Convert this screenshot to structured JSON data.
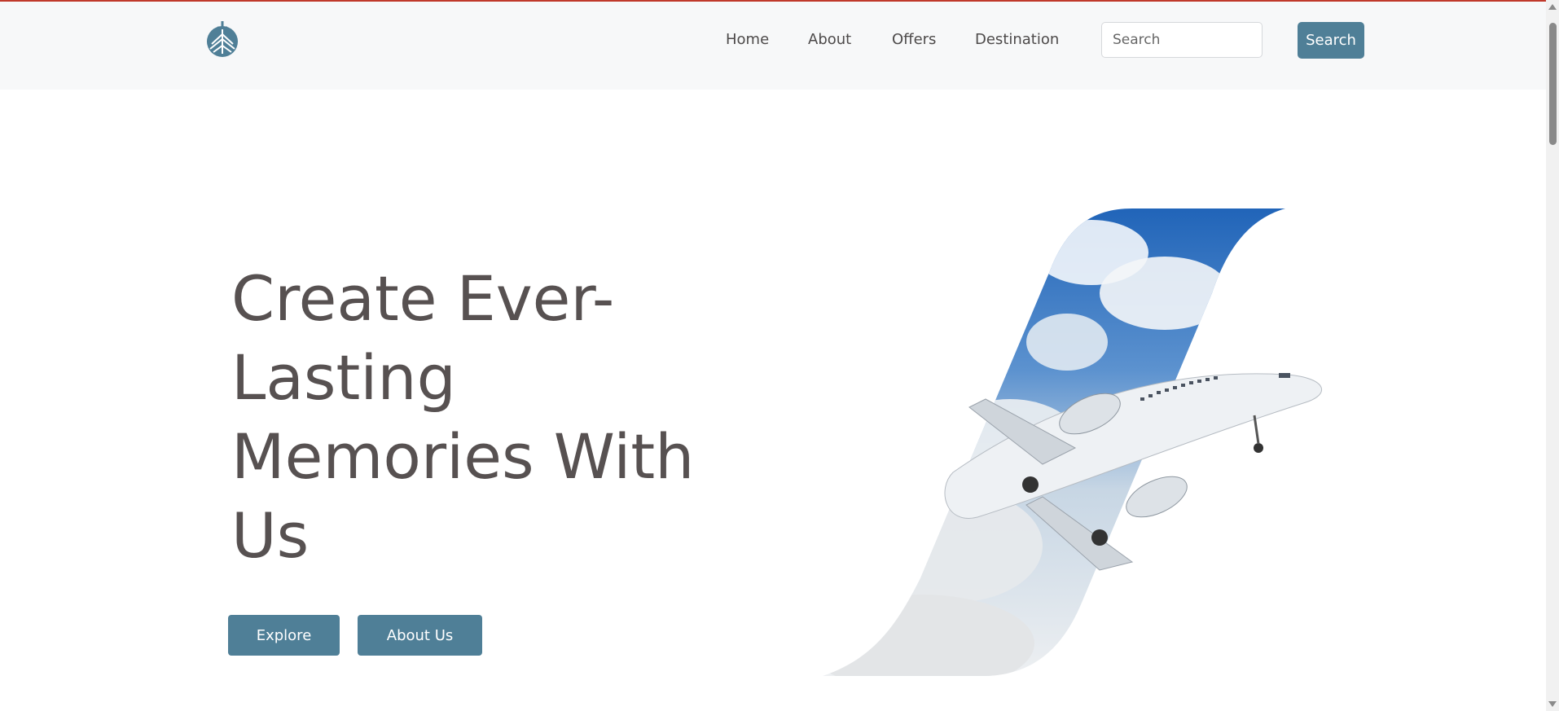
{
  "nav": {
    "logo": "ship-logo-icon",
    "links": [
      {
        "label": "Home"
      },
      {
        "label": "About"
      },
      {
        "label": "Offers"
      },
      {
        "label": "Destination"
      }
    ],
    "search": {
      "placeholder": "Search",
      "button_label": "Search"
    }
  },
  "hero": {
    "title_lines": [
      "Create Ever-",
      "Lasting",
      "Memories With",
      "Us"
    ],
    "buttons": {
      "explore": "Explore",
      "about": "About Us"
    },
    "image": "airplane-in-clouds-image"
  },
  "colors": {
    "accent": "#4f7f97",
    "heading": "#575151",
    "nav_background": "#f7f8f9",
    "top_border": "#c0392b"
  }
}
